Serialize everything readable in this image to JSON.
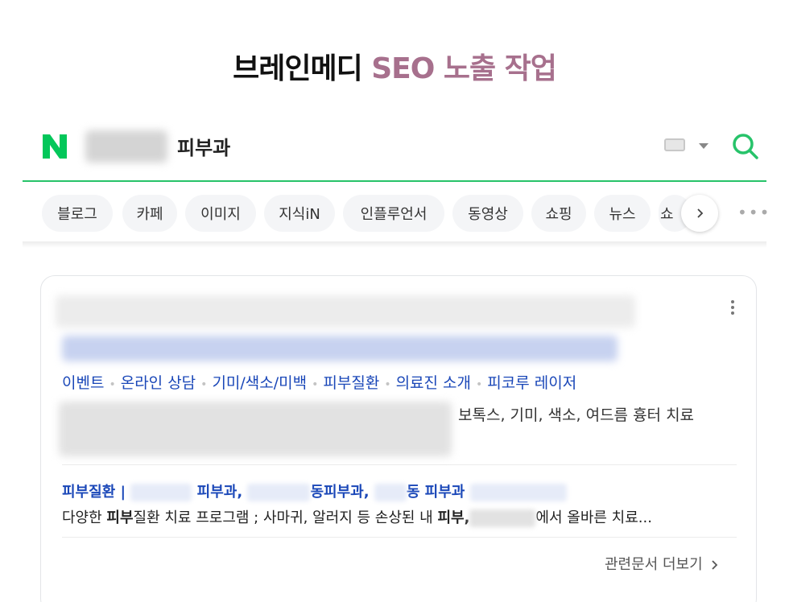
{
  "headline": {
    "prefix": "브레인메디 ",
    "accent": "SEO 노출 작업"
  },
  "colors": {
    "brand_green": "#27c36a",
    "accent_purple": "#a7708d",
    "link_blue": "#1a47b8"
  },
  "search": {
    "logo": "N",
    "query": "피부과",
    "icons": [
      "naver-logo",
      "keyboard-icon",
      "dropdown-icon",
      "search-icon"
    ]
  },
  "tabs": [
    "블로그",
    "카페",
    "이미지",
    "지식iN",
    "인플루언서",
    "동영상",
    "쇼핑",
    "뉴스",
    "쇼"
  ],
  "tab_more": "•••",
  "result": {
    "sitelinks": [
      "이벤트",
      "온라인 상담",
      "기미/색소/미백",
      "피부질환",
      "의료진 소개",
      "피코루 레이저"
    ],
    "description_visible": "보톡스, 기미, 색소, 여드름 흉터 치료",
    "related": {
      "title_parts": [
        "피부질환 |",
        "피부과,",
        "동피부과,",
        "동 피부과"
      ],
      "desc_pre": "다양한 ",
      "desc_bold1": "피부",
      "desc_mid": "질환 치료 프로그램 ; 사마귀, 알러지 등 손상된 내 ",
      "desc_bold2": "피부,",
      "desc_post": "에서 올바른 치료..."
    },
    "more_docs": "관련문서 더보기"
  }
}
